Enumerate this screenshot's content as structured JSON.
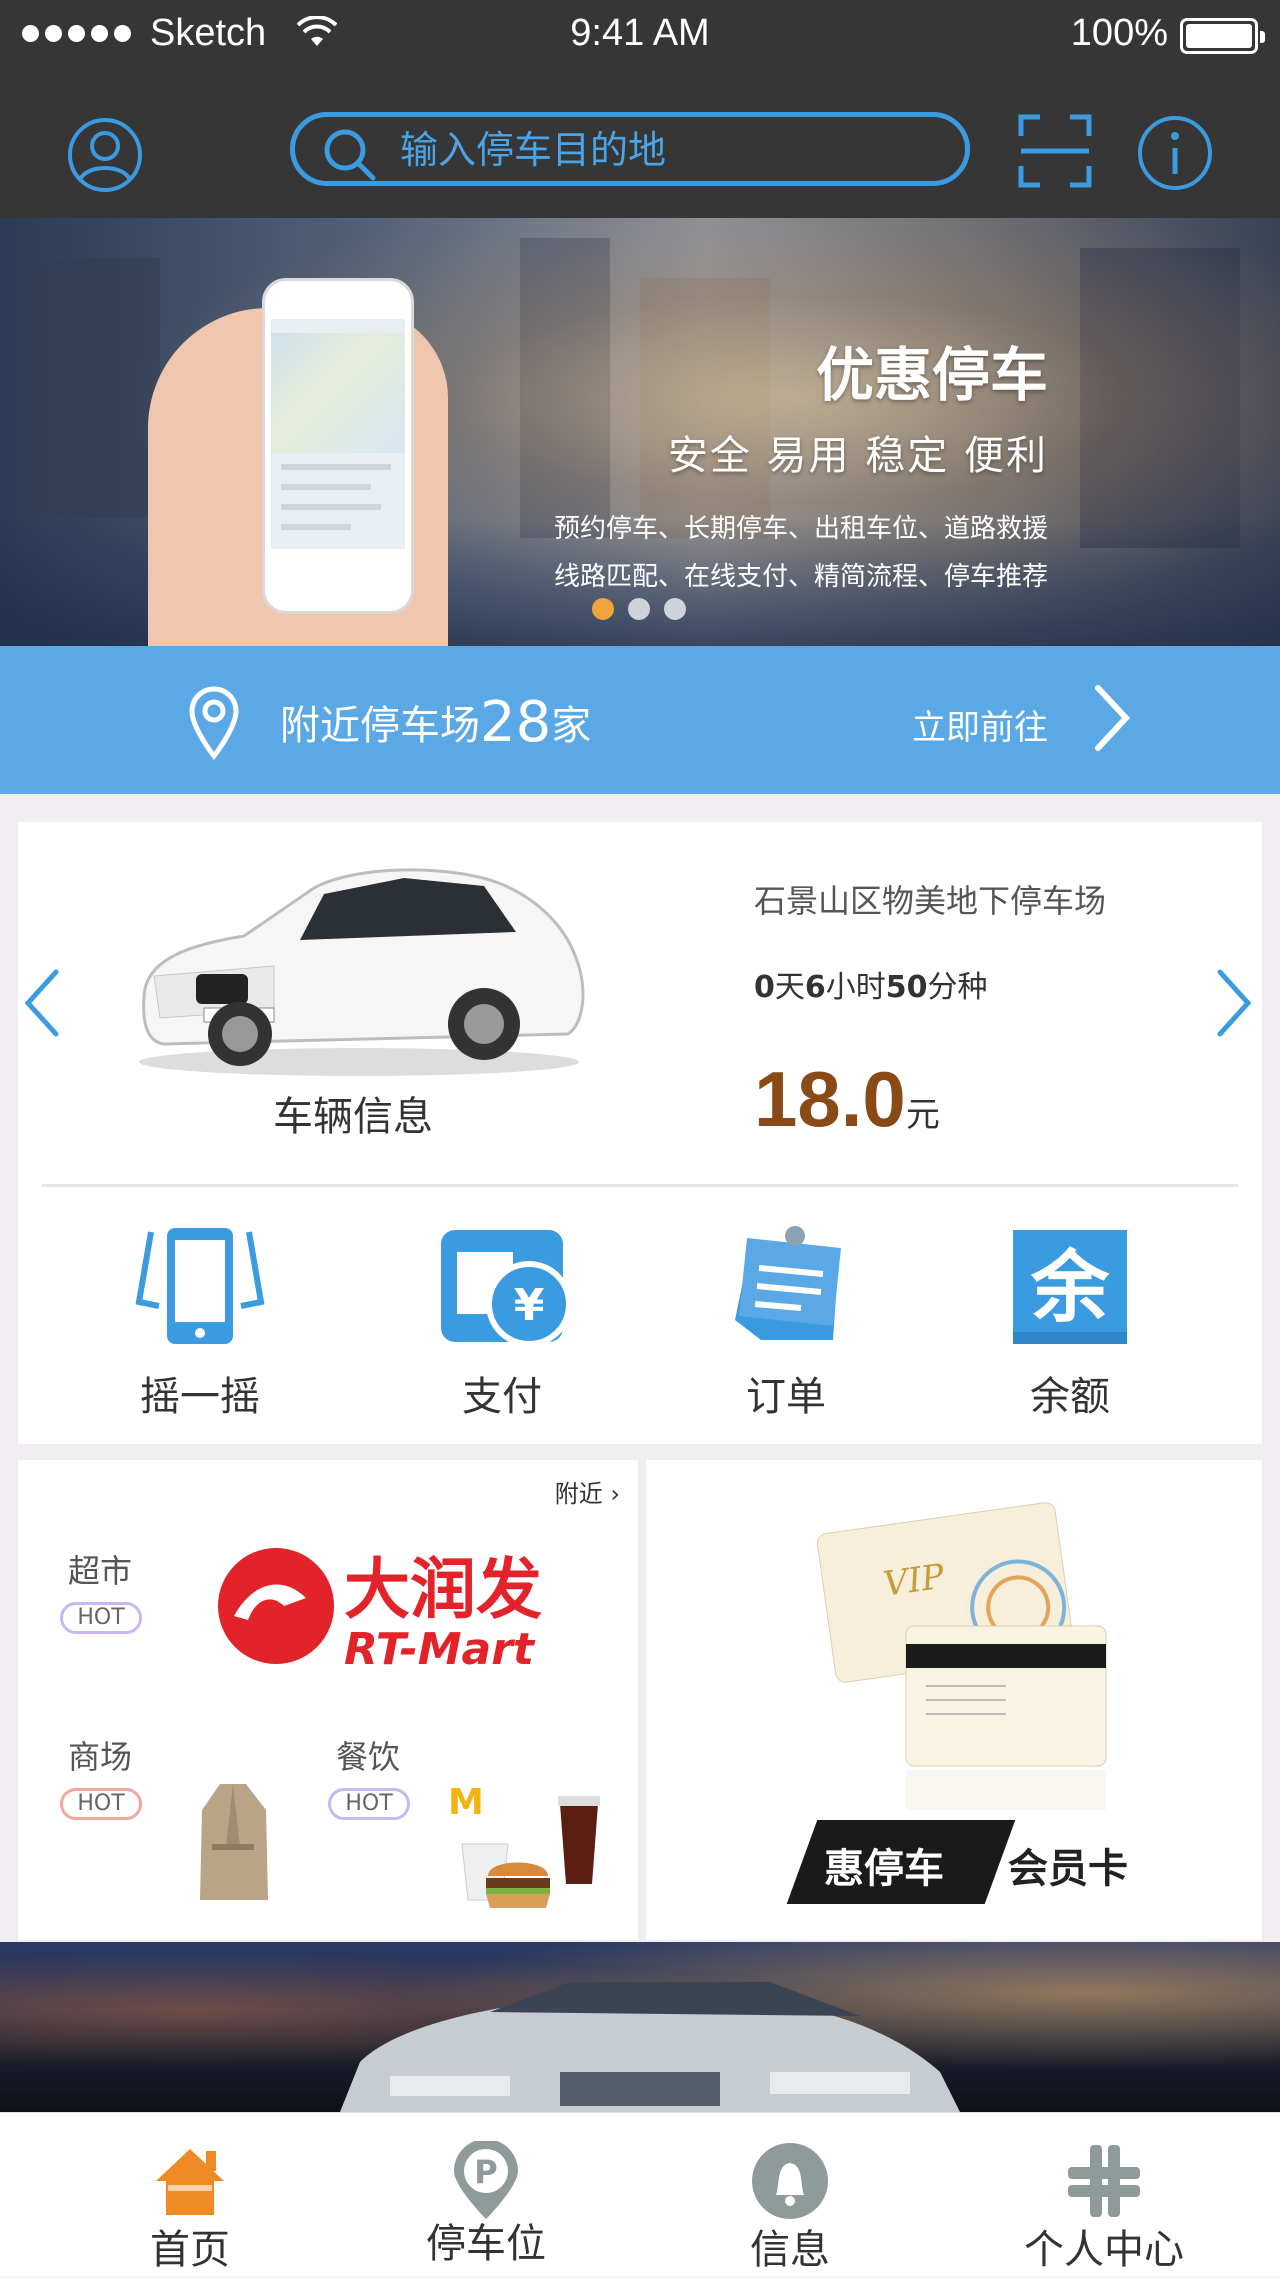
{
  "status_bar": {
    "carrier": "Sketch",
    "time": "9:41 AM",
    "battery": "100%"
  },
  "header": {
    "search_placeholder": "输入停车目的地"
  },
  "banner": {
    "title": "优惠停车",
    "subtitle": "安全 易用 稳定 便利",
    "line1": "预约停车、长期停车、出租车位、道路救援",
    "line2": "线路匹配、在线支付、精简流程、停车推荐",
    "page_count": 3,
    "active_page": 1
  },
  "nearby": {
    "prefix": "附近停车场",
    "count": "28",
    "suffix": "家",
    "action": "立即前往"
  },
  "vehicle": {
    "label": "车辆信息",
    "lot_name": "石景山区物美地下停车场",
    "duration": {
      "days": "0",
      "days_unit": "天",
      "hours": "6",
      "hours_unit": "小时",
      "minutes": "50",
      "minutes_unit": "分种"
    },
    "price": "18.0",
    "price_unit": "元"
  },
  "actions": [
    {
      "label": "摇一摇",
      "icon": "shake-phone-icon"
    },
    {
      "label": "支付",
      "icon": "wallet-yuan-icon"
    },
    {
      "label": "订单",
      "icon": "order-note-icon"
    },
    {
      "label": "余额",
      "icon": "balance-yu-icon"
    }
  ],
  "promo": {
    "more": "附近",
    "supermarket": {
      "label": "超市",
      "hot": "HOT",
      "brand_cn": "大润发",
      "brand_en": "RT-Mart"
    },
    "mall": {
      "label": "商场",
      "hot": "HOT"
    },
    "dining": {
      "label": "餐饮",
      "hot": "HOT"
    },
    "membership": {
      "badge": "惠停车",
      "text": "会员卡",
      "card_title": "VIP"
    }
  },
  "tabs": [
    {
      "label": "首页",
      "icon": "home-icon"
    },
    {
      "label": "停车位",
      "icon": "parking-pin-icon"
    },
    {
      "label": "信息",
      "icon": "bell-icon"
    },
    {
      "label": "个人中心",
      "icon": "grid-plus-icon"
    }
  ],
  "colors": {
    "accent": "#5aa9e6",
    "nav_bg": "#363636",
    "price": "#8a4a16",
    "home_active": "#f08a24",
    "tab_icon": "#8f9a9a"
  }
}
